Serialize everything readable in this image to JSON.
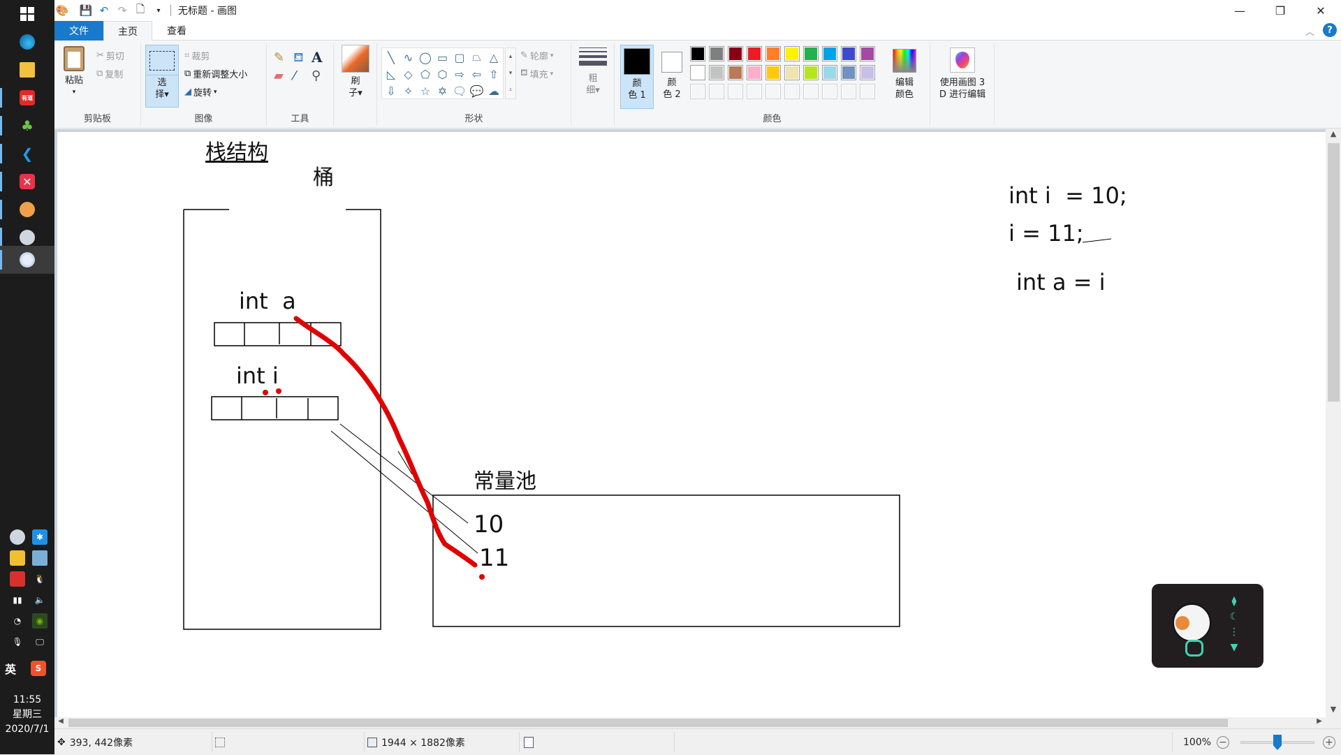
{
  "window": {
    "title": "无标题 - 画图",
    "controls": {
      "minimize": "—",
      "restore": "❐",
      "close": "✕"
    },
    "quick_access": [
      "save-icon",
      "undo-icon",
      "redo-icon",
      "print-preview-icon",
      "customize-dropdown-icon"
    ]
  },
  "tabs": [
    {
      "label": "文件"
    },
    {
      "label": "主页"
    },
    {
      "label": "查看"
    }
  ],
  "ribbon": {
    "clipboard": {
      "group_label": "剪贴板",
      "paste": "粘贴",
      "cut": "剪切",
      "copy": "复制"
    },
    "image": {
      "group_label": "图像",
      "select": "选\n择",
      "crop": "裁剪",
      "resize": "重新调整大小",
      "rotate": "旋转"
    },
    "tools": {
      "group_label": "工具",
      "items": [
        "pencil-icon",
        "fill-bucket-icon",
        "text-icon",
        "eraser-icon",
        "color-picker-icon",
        "magnifier-icon"
      ]
    },
    "brushes": {
      "label_line1": "刷",
      "label_line2": "子"
    },
    "shapes": {
      "group_label": "形状",
      "outline": "轮廓",
      "fill": "填充",
      "glyphs": [
        "╲",
        "∿",
        "◯",
        "▭",
        "▢",
        "⏢",
        "△",
        "◺",
        "◇",
        "⬠",
        "⬡",
        "⇨",
        "⇦",
        "⇧",
        "⇩",
        "✧",
        "☆",
        "✡",
        "🗨",
        "💬",
        "☁"
      ]
    },
    "size": {
      "label_line1": "粗",
      "label_line2": "细"
    },
    "colors": {
      "group_label": "颜色",
      "color1_line1": "颜",
      "color1_line2": "色 1",
      "color2_line1": "颜",
      "color2_line2": "色 2",
      "color1_value": "#000000",
      "color2_value": "#ffffff",
      "palette_row1": [
        "#000000",
        "#7f7f7f",
        "#880015",
        "#ed1c24",
        "#ff7f27",
        "#fff200",
        "#22b14c",
        "#00a2e8",
        "#3f48cc",
        "#a349a4"
      ],
      "palette_row2": [
        "#ffffff",
        "#c3c3c3",
        "#b97a57",
        "#ffaec9",
        "#ffc90e",
        "#efe4b0",
        "#b5e61d",
        "#99d9ea",
        "#7092be",
        "#c8bfe7"
      ],
      "edit_colors_line1": "编辑",
      "edit_colors_line2": "颜色"
    },
    "paint3d": {
      "line1": "使用画图 3",
      "line2": "D 进行编辑"
    }
  },
  "canvas": {
    "title": "栈结构",
    "bucket_label": "桶",
    "var_a_label": "int  a",
    "var_i_label": "int i",
    "pool_label": "常量池",
    "pool_values": [
      "10",
      "11"
    ],
    "code_lines": [
      "int i  = 10;",
      "i = 11;",
      "int a = i"
    ],
    "stroke_color": "#e00000"
  },
  "statusbar": {
    "cursor_pos": "393, 442像素",
    "selection_size": "",
    "canvas_size": "1944 × 1882像素",
    "zoom": "100%"
  },
  "taskbar": {
    "apps": [
      "windows-start-icon",
      "edge-icon",
      "file-explorer-icon",
      "youdao-icon",
      "clover-icon",
      "vscode-icon",
      "xmind-icon",
      "sublime-like-icon",
      "network-monitor-icon",
      "paint-icon"
    ],
    "youdao_text": "有道",
    "ime": "英",
    "time": "11:55",
    "weekday": "星期三",
    "date": "2020/7/1"
  }
}
